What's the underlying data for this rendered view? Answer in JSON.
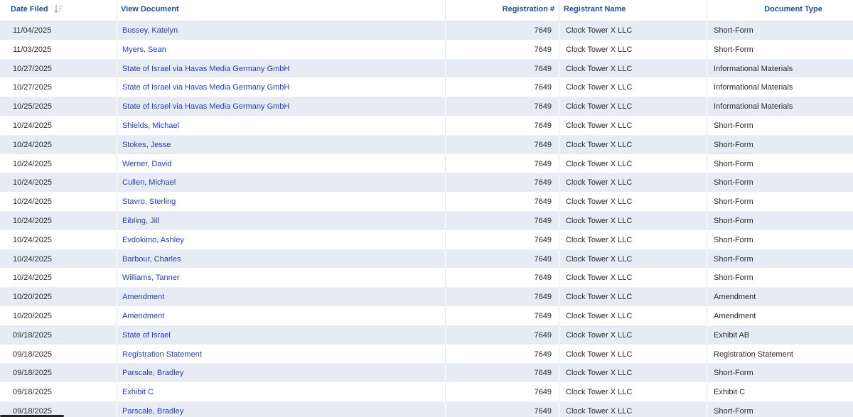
{
  "table": {
    "columns": {
      "date_filed": "Date Filed",
      "view_document": "View Document",
      "registration": "Registration #",
      "registrant_name": "Registrant Name",
      "document_type": "Document Type"
    },
    "sort_icon": "sort-descending-icon",
    "link_color": "#2340b8",
    "header_color": "#1f4e9a",
    "stripe_color": "#e7ebf4",
    "rows": [
      {
        "date": "11/04/2025",
        "doc": "Bussey, Katelyn",
        "reg": "7649",
        "name": "Clock Tower X LLC",
        "type": "Short-Form"
      },
      {
        "date": "11/03/2025",
        "doc": "Myers, Sean",
        "reg": "7649",
        "name": "Clock Tower X LLC",
        "type": "Short-Form"
      },
      {
        "date": "10/27/2025",
        "doc": "State of Israel via Havas Media Germany GmbH",
        "reg": "7649",
        "name": "Clock Tower X LLC",
        "type": "Informational Materials"
      },
      {
        "date": "10/27/2025",
        "doc": "State of Israel via Havas Media Germany GmbH",
        "reg": "7649",
        "name": "Clock Tower X LLC",
        "type": "Informational Materials"
      },
      {
        "date": "10/25/2025",
        "doc": "State of Israel via Havas Media Germany GmbH",
        "reg": "7649",
        "name": "Clock Tower X LLC",
        "type": "Informational Materials"
      },
      {
        "date": "10/24/2025",
        "doc": "Shields, Michael",
        "reg": "7649",
        "name": "Clock Tower X LLC",
        "type": "Short-Form"
      },
      {
        "date": "10/24/2025",
        "doc": "Stokes, Jesse",
        "reg": "7649",
        "name": "Clock Tower X LLC",
        "type": "Short-Form"
      },
      {
        "date": "10/24/2025",
        "doc": "Werner, David",
        "reg": "7649",
        "name": "Clock Tower X LLC",
        "type": "Short-Form"
      },
      {
        "date": "10/24/2025",
        "doc": "Cullen, Michael",
        "reg": "7649",
        "name": "Clock Tower X LLC",
        "type": "Short-Form"
      },
      {
        "date": "10/24/2025",
        "doc": "Stavro, Sterling",
        "reg": "7649",
        "name": "Clock Tower X LLC",
        "type": "Short-Form"
      },
      {
        "date": "10/24/2025",
        "doc": "Eibling, Jill",
        "reg": "7649",
        "name": "Clock Tower X LLC",
        "type": "Short-Form"
      },
      {
        "date": "10/24/2025",
        "doc": "Evdokimo, Ashley",
        "reg": "7649",
        "name": "Clock Tower X LLC",
        "type": "Short-Form"
      },
      {
        "date": "10/24/2025",
        "doc": "Barbour, Charles",
        "reg": "7649",
        "name": "Clock Tower X LLC",
        "type": "Short-Form"
      },
      {
        "date": "10/24/2025",
        "doc": "Williams, Tanner",
        "reg": "7649",
        "name": "Clock Tower X LLC",
        "type": "Short-Form"
      },
      {
        "date": "10/20/2025",
        "doc": "Amendment",
        "reg": "7649",
        "name": "Clock Tower X LLC",
        "type": "Amendment"
      },
      {
        "date": "10/20/2025",
        "doc": "Amendment",
        "reg": "7649",
        "name": "Clock Tower X LLC",
        "type": "Amendment"
      },
      {
        "date": "09/18/2025",
        "doc": "State of Israel",
        "reg": "7649",
        "name": "Clock Tower X LLC",
        "type": "Exhibit AB"
      },
      {
        "date": "09/18/2025",
        "doc": "Registration Statement",
        "reg": "7649",
        "name": "Clock Tower X LLC",
        "type": "Registration Statement"
      },
      {
        "date": "09/18/2025",
        "doc": "Parscale, Bradley",
        "reg": "7649",
        "name": "Clock Tower X LLC",
        "type": "Short-Form"
      },
      {
        "date": "09/18/2025",
        "doc": "Exhibit C",
        "reg": "7649",
        "name": "Clock Tower X LLC",
        "type": "Exhibit C"
      },
      {
        "date": "09/18/2025",
        "doc": "Parscale, Bradley",
        "reg": "7649",
        "name": "Clock Tower X LLC",
        "type": "Short-Form"
      }
    ]
  }
}
